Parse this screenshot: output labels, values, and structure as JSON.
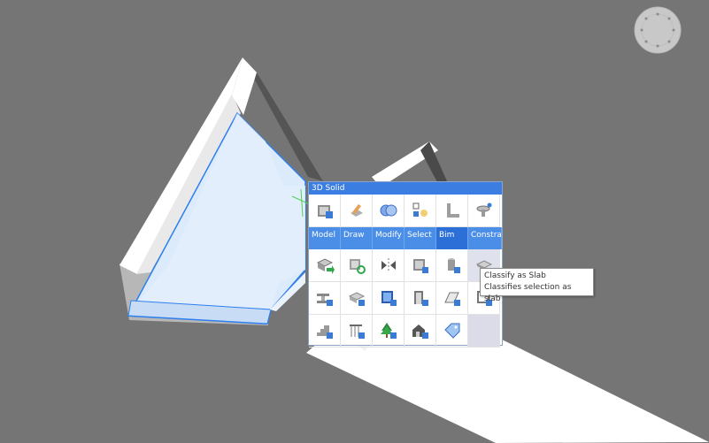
{
  "quad": {
    "title": "3D Solid",
    "tabs": [
      {
        "label": "Model",
        "active": false
      },
      {
        "label": "Draw",
        "active": false
      },
      {
        "label": "Modify",
        "active": false
      },
      {
        "label": "Select",
        "active": false
      },
      {
        "label": "Bim",
        "active": true
      },
      {
        "label": "Constraints",
        "active": false
      }
    ],
    "top_icons": [
      "bim-wall-icon",
      "draw-solid-icon",
      "union-icon",
      "select-similar-icon",
      "l-shape-profile-icon",
      "constraint-icon"
    ],
    "grid_icons": [
      [
        "bim-export-icon",
        "bim-refresh-icon",
        "mirror-icon",
        "classify-wall-icon",
        "classify-column-icon",
        "classify-slab-icon"
      ],
      [
        "classify-beam-icon",
        "classify-generic-icon",
        "classify-window-icon",
        "classify-door-icon",
        "classify-plate-icon",
        "classify-opening-icon"
      ],
      [
        "classify-stair-icon",
        "classify-railing-icon",
        "classify-tree-icon",
        "classify-building-icon",
        "tag-icon",
        ""
      ]
    ],
    "hover_item": "classify-slab-icon"
  },
  "tooltip": {
    "title": "Classify as Slab",
    "description": "Classifies selection as slab"
  },
  "colors": {
    "background": "#757575",
    "title_bar": "#3b7de0",
    "tab_bar": "#4a8ee8",
    "tab_active": "#2c6fd6",
    "selection": "#2d7ff0"
  }
}
